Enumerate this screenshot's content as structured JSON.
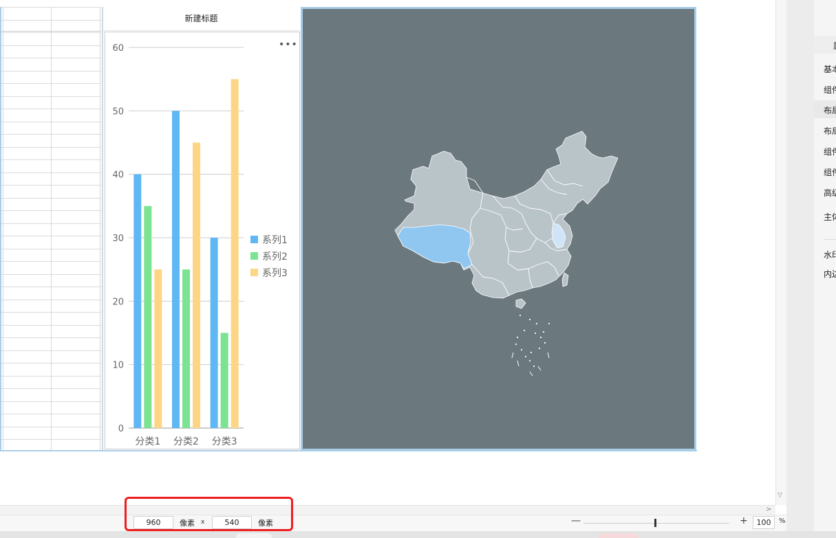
{
  "chart_widget": {
    "title": "新建标题",
    "more_icon": "more-icon"
  },
  "chart_data": {
    "type": "bar",
    "categories": [
      "分类1",
      "分类2",
      "分类3"
    ],
    "series": [
      {
        "name": "系列1",
        "values": [
          40,
          50,
          30
        ],
        "color": "#5fb8f4"
      },
      {
        "name": "系列2",
        "values": [
          35,
          25,
          15
        ],
        "color": "#7be391"
      },
      {
        "name": "系列3",
        "values": [
          25,
          45,
          55
        ],
        "color": "#fcd685"
      }
    ],
    "ylim": [
      0,
      60
    ],
    "yticks": [
      "0",
      "10",
      "20",
      "30",
      "40",
      "50",
      "60"
    ],
    "grid": true,
    "legend": "right"
  },
  "map_widget": {
    "background": "#6b787e",
    "province_color": "#b9c4c9",
    "highlight_colors": [
      "#8fc7f1",
      "#cfe5f7"
    ]
  },
  "status": {
    "width_value": "960",
    "width_unit": "像素",
    "separator": "x",
    "height_value": "540",
    "height_unit": "像素",
    "zoom_minus": "—",
    "zoom_plus": "+",
    "zoom_value": "100",
    "zoom_unit": "%"
  },
  "right_panel": {
    "items": [
      {
        "label": "属",
        "key": "tab"
      },
      {
        "label": "基本",
        "key": "basic"
      },
      {
        "label": "组件",
        "key": "component-1"
      },
      {
        "label": "布局",
        "key": "layout-1"
      },
      {
        "label": "布局",
        "key": "layout-2"
      },
      {
        "label": "组件",
        "key": "component-2"
      },
      {
        "label": "组件",
        "key": "component-3"
      },
      {
        "label": "高级",
        "key": "advanced"
      },
      {
        "label": "主体",
        "key": "theme"
      },
      {
        "label": "水印",
        "key": "watermark"
      },
      {
        "label": "内边",
        "key": "padding"
      }
    ]
  },
  "colors": {
    "frame": "#a9cde9",
    "highlight_box": "#ee1c1c"
  }
}
